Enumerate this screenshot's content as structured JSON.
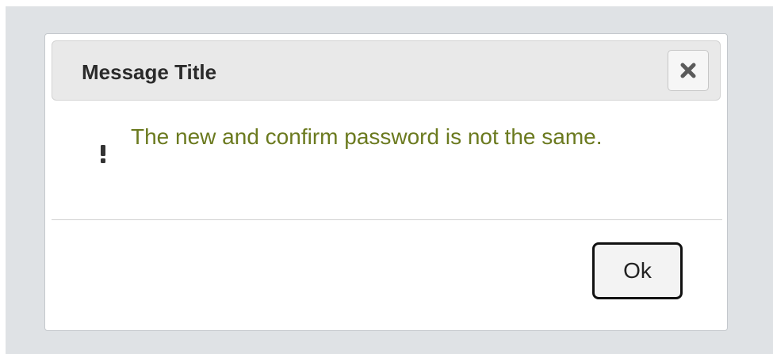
{
  "dialog": {
    "title": "Message Title",
    "close_icon": "close-x-icon",
    "message_icon": "exclamation-icon",
    "message": "The new and confirm password is not the same.",
    "ok_label": "Ok"
  },
  "colors": {
    "backdrop": "#dfe2e5",
    "titlebar": "#e9e9e9",
    "message_text": "#6b7a1f",
    "ok_border": "#111111"
  }
}
